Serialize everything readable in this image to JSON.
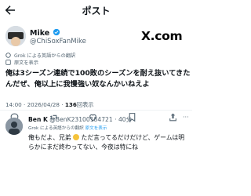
{
  "header": {
    "title": "ポスト"
  },
  "author": {
    "name": "Mike",
    "handle": "@ChiSoxFanMike",
    "verified_color": "#1d9bf0"
  },
  "brand": {
    "logo_text": "X.com"
  },
  "notes": {
    "translated": "Grok による英語からの翻訳",
    "view_original": "原文を表示"
  },
  "post": {
    "lines": [
      "俺は3シーズン連続で100敗のシーズンを耐え抜いてきた",
      "んだぜ、俺以上に我慢強い奴なんかいねえよ"
    ],
    "time": "14:00 · 2026/04/28 · ",
    "views_count": "136",
    "views_label": "回表示"
  },
  "reply": {
    "name": "Ben K",
    "handle_time": "@BenK231001847​21 · 40分",
    "translated_prefix": "Grok による英語からの翻訳",
    "view_original": "原文を表示",
    "line1_before": "俺もだよ、兄弟",
    "line1_after": "ただ言ってるだけだけど、ゲームは明",
    "line2": "らかにまだ終わってない、今夜は特にね",
    "more": "···"
  },
  "colors": {
    "accent": "#1d9bf0",
    "muted": "#536471",
    "text": "#0f1419"
  }
}
